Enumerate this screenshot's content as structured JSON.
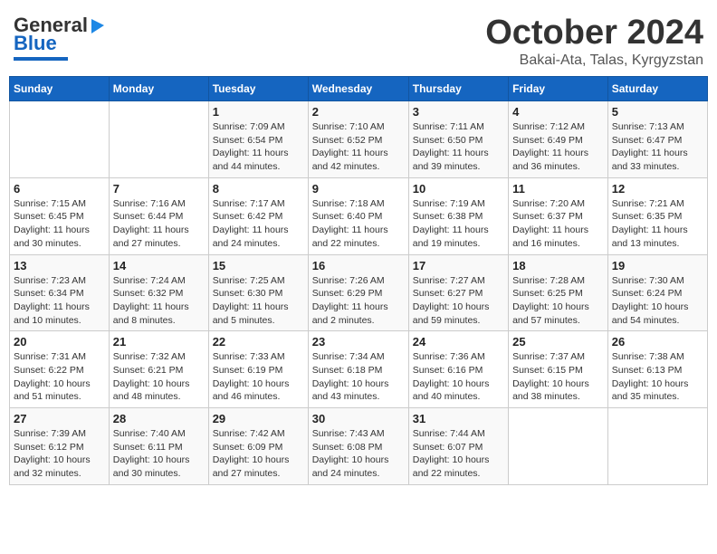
{
  "header": {
    "logo_general": "General",
    "logo_blue": "Blue",
    "month": "October 2024",
    "location": "Bakai-Ata, Talas, Kyrgyzstan"
  },
  "days_of_week": [
    "Sunday",
    "Monday",
    "Tuesday",
    "Wednesday",
    "Thursday",
    "Friday",
    "Saturday"
  ],
  "weeks": [
    [
      {
        "day": "",
        "sunrise": "",
        "sunset": "",
        "daylight": ""
      },
      {
        "day": "",
        "sunrise": "",
        "sunset": "",
        "daylight": ""
      },
      {
        "day": "1",
        "sunrise": "Sunrise: 7:09 AM",
        "sunset": "Sunset: 6:54 PM",
        "daylight": "Daylight: 11 hours and 44 minutes."
      },
      {
        "day": "2",
        "sunrise": "Sunrise: 7:10 AM",
        "sunset": "Sunset: 6:52 PM",
        "daylight": "Daylight: 11 hours and 42 minutes."
      },
      {
        "day": "3",
        "sunrise": "Sunrise: 7:11 AM",
        "sunset": "Sunset: 6:50 PM",
        "daylight": "Daylight: 11 hours and 39 minutes."
      },
      {
        "day": "4",
        "sunrise": "Sunrise: 7:12 AM",
        "sunset": "Sunset: 6:49 PM",
        "daylight": "Daylight: 11 hours and 36 minutes."
      },
      {
        "day": "5",
        "sunrise": "Sunrise: 7:13 AM",
        "sunset": "Sunset: 6:47 PM",
        "daylight": "Daylight: 11 hours and 33 minutes."
      }
    ],
    [
      {
        "day": "6",
        "sunrise": "Sunrise: 7:15 AM",
        "sunset": "Sunset: 6:45 PM",
        "daylight": "Daylight: 11 hours and 30 minutes."
      },
      {
        "day": "7",
        "sunrise": "Sunrise: 7:16 AM",
        "sunset": "Sunset: 6:44 PM",
        "daylight": "Daylight: 11 hours and 27 minutes."
      },
      {
        "day": "8",
        "sunrise": "Sunrise: 7:17 AM",
        "sunset": "Sunset: 6:42 PM",
        "daylight": "Daylight: 11 hours and 24 minutes."
      },
      {
        "day": "9",
        "sunrise": "Sunrise: 7:18 AM",
        "sunset": "Sunset: 6:40 PM",
        "daylight": "Daylight: 11 hours and 22 minutes."
      },
      {
        "day": "10",
        "sunrise": "Sunrise: 7:19 AM",
        "sunset": "Sunset: 6:38 PM",
        "daylight": "Daylight: 11 hours and 19 minutes."
      },
      {
        "day": "11",
        "sunrise": "Sunrise: 7:20 AM",
        "sunset": "Sunset: 6:37 PM",
        "daylight": "Daylight: 11 hours and 16 minutes."
      },
      {
        "day": "12",
        "sunrise": "Sunrise: 7:21 AM",
        "sunset": "Sunset: 6:35 PM",
        "daylight": "Daylight: 11 hours and 13 minutes."
      }
    ],
    [
      {
        "day": "13",
        "sunrise": "Sunrise: 7:23 AM",
        "sunset": "Sunset: 6:34 PM",
        "daylight": "Daylight: 11 hours and 10 minutes."
      },
      {
        "day": "14",
        "sunrise": "Sunrise: 7:24 AM",
        "sunset": "Sunset: 6:32 PM",
        "daylight": "Daylight: 11 hours and 8 minutes."
      },
      {
        "day": "15",
        "sunrise": "Sunrise: 7:25 AM",
        "sunset": "Sunset: 6:30 PM",
        "daylight": "Daylight: 11 hours and 5 minutes."
      },
      {
        "day": "16",
        "sunrise": "Sunrise: 7:26 AM",
        "sunset": "Sunset: 6:29 PM",
        "daylight": "Daylight: 11 hours and 2 minutes."
      },
      {
        "day": "17",
        "sunrise": "Sunrise: 7:27 AM",
        "sunset": "Sunset: 6:27 PM",
        "daylight": "Daylight: 10 hours and 59 minutes."
      },
      {
        "day": "18",
        "sunrise": "Sunrise: 7:28 AM",
        "sunset": "Sunset: 6:25 PM",
        "daylight": "Daylight: 10 hours and 57 minutes."
      },
      {
        "day": "19",
        "sunrise": "Sunrise: 7:30 AM",
        "sunset": "Sunset: 6:24 PM",
        "daylight": "Daylight: 10 hours and 54 minutes."
      }
    ],
    [
      {
        "day": "20",
        "sunrise": "Sunrise: 7:31 AM",
        "sunset": "Sunset: 6:22 PM",
        "daylight": "Daylight: 10 hours and 51 minutes."
      },
      {
        "day": "21",
        "sunrise": "Sunrise: 7:32 AM",
        "sunset": "Sunset: 6:21 PM",
        "daylight": "Daylight: 10 hours and 48 minutes."
      },
      {
        "day": "22",
        "sunrise": "Sunrise: 7:33 AM",
        "sunset": "Sunset: 6:19 PM",
        "daylight": "Daylight: 10 hours and 46 minutes."
      },
      {
        "day": "23",
        "sunrise": "Sunrise: 7:34 AM",
        "sunset": "Sunset: 6:18 PM",
        "daylight": "Daylight: 10 hours and 43 minutes."
      },
      {
        "day": "24",
        "sunrise": "Sunrise: 7:36 AM",
        "sunset": "Sunset: 6:16 PM",
        "daylight": "Daylight: 10 hours and 40 minutes."
      },
      {
        "day": "25",
        "sunrise": "Sunrise: 7:37 AM",
        "sunset": "Sunset: 6:15 PM",
        "daylight": "Daylight: 10 hours and 38 minutes."
      },
      {
        "day": "26",
        "sunrise": "Sunrise: 7:38 AM",
        "sunset": "Sunset: 6:13 PM",
        "daylight": "Daylight: 10 hours and 35 minutes."
      }
    ],
    [
      {
        "day": "27",
        "sunrise": "Sunrise: 7:39 AM",
        "sunset": "Sunset: 6:12 PM",
        "daylight": "Daylight: 10 hours and 32 minutes."
      },
      {
        "day": "28",
        "sunrise": "Sunrise: 7:40 AM",
        "sunset": "Sunset: 6:11 PM",
        "daylight": "Daylight: 10 hours and 30 minutes."
      },
      {
        "day": "29",
        "sunrise": "Sunrise: 7:42 AM",
        "sunset": "Sunset: 6:09 PM",
        "daylight": "Daylight: 10 hours and 27 minutes."
      },
      {
        "day": "30",
        "sunrise": "Sunrise: 7:43 AM",
        "sunset": "Sunset: 6:08 PM",
        "daylight": "Daylight: 10 hours and 24 minutes."
      },
      {
        "day": "31",
        "sunrise": "Sunrise: 7:44 AM",
        "sunset": "Sunset: 6:07 PM",
        "daylight": "Daylight: 10 hours and 22 minutes."
      },
      {
        "day": "",
        "sunrise": "",
        "sunset": "",
        "daylight": ""
      },
      {
        "day": "",
        "sunrise": "",
        "sunset": "",
        "daylight": ""
      }
    ]
  ]
}
